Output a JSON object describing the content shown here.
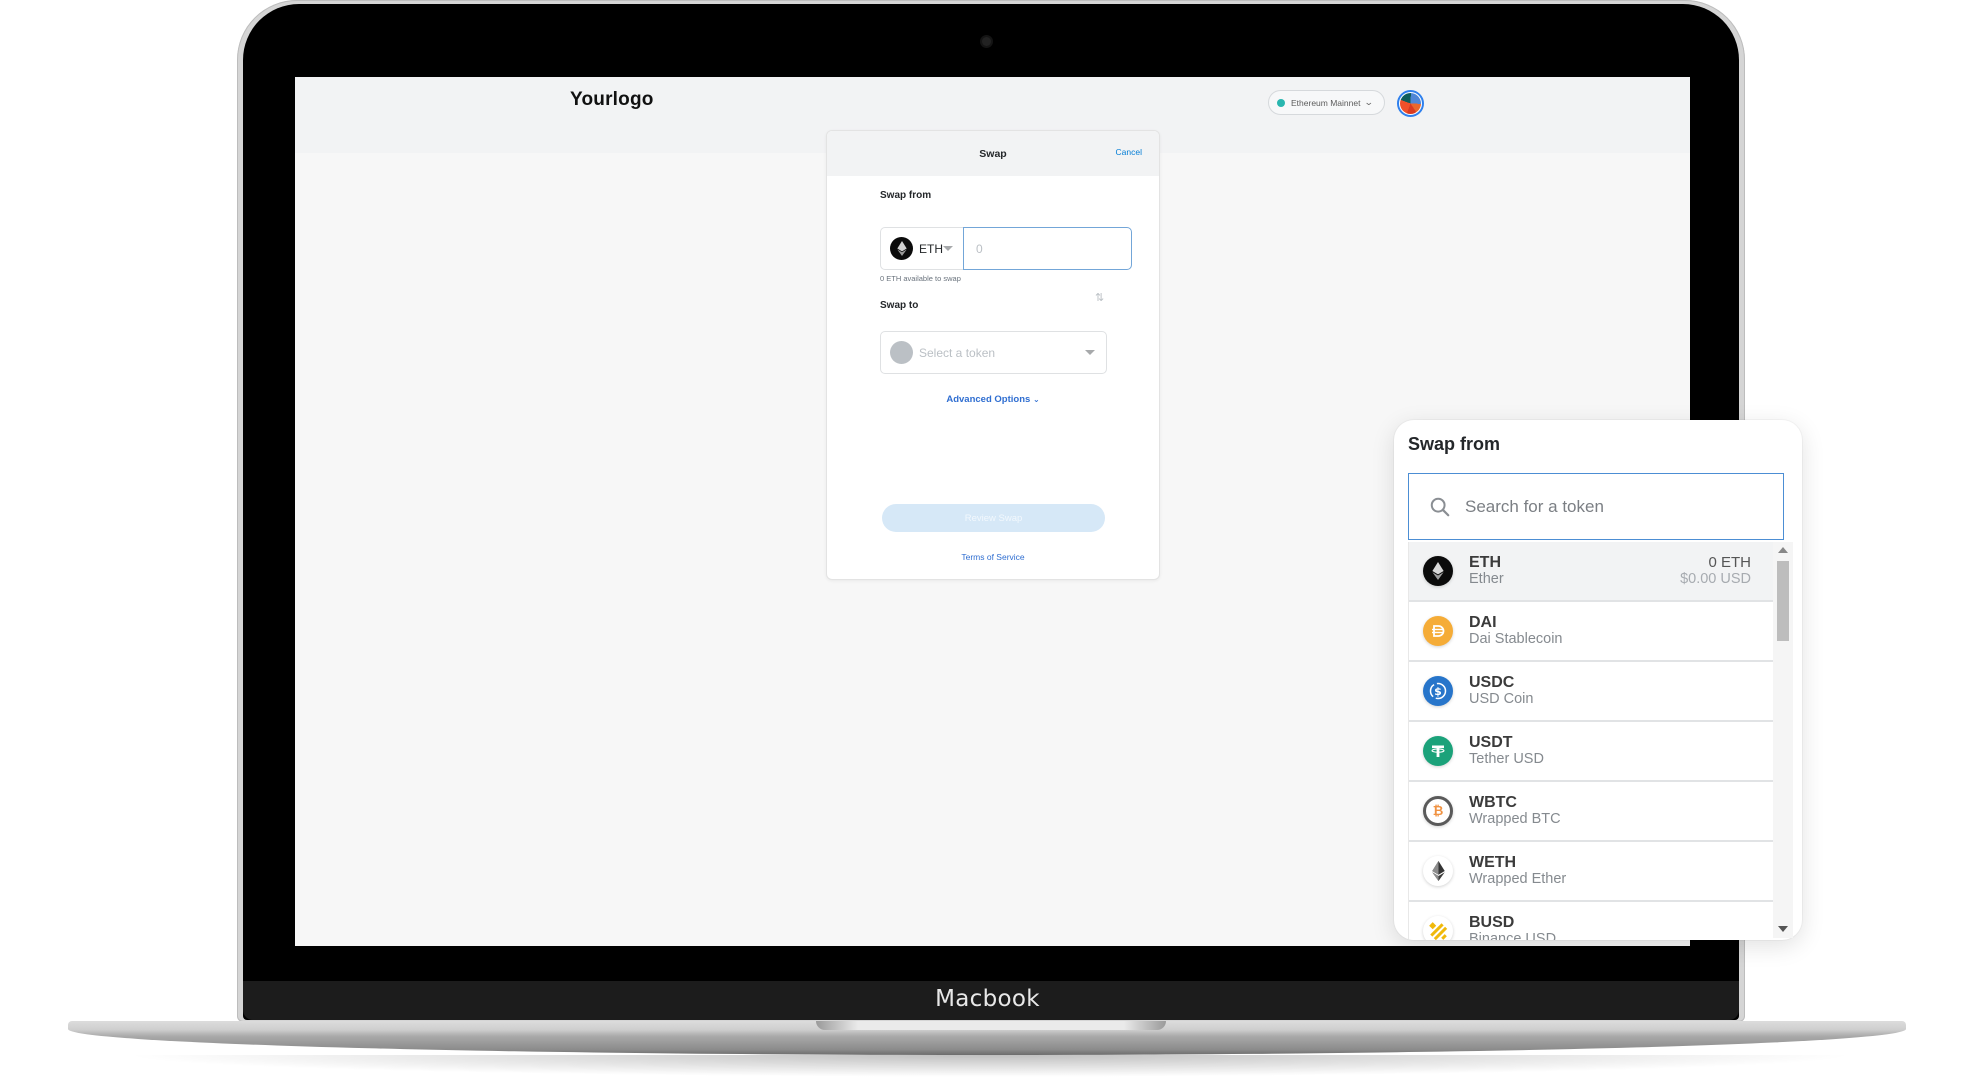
{
  "device": {
    "label": "Macbook"
  },
  "app": {
    "logo": "Yourlogo",
    "network": {
      "label": "Ethereum Mainnet",
      "status_color": "#29b6af"
    },
    "account_avatar": "account-avatar"
  },
  "swap_card": {
    "title": "Swap",
    "cancel_label": "Cancel",
    "from": {
      "label": "Swap from",
      "token": "ETH",
      "amount_placeholder": "0",
      "available": "0 ETH available to swap"
    },
    "switch_icon": "switch-arrows-icon",
    "to": {
      "label": "Swap to",
      "placeholder": "Select a token"
    },
    "advanced_options_label": "Advanced Options",
    "review_label": "Review Swap",
    "terms_label": "Terms of Service",
    "accent_color": "#037dd6"
  },
  "token_picker": {
    "title": "Swap from",
    "search_placeholder": "Search for a token",
    "tokens": [
      {
        "symbol": "ETH",
        "name": "Ether",
        "balance": "0 ETH",
        "balance_usd": "$0.00 USD",
        "selected": true,
        "icon": "eth-icon",
        "color": "#0b0b0b"
      },
      {
        "symbol": "DAI",
        "name": "Dai Stablecoin",
        "icon": "dai-icon",
        "color": "#f5ac37"
      },
      {
        "symbol": "USDC",
        "name": "USD Coin",
        "icon": "usdc-icon",
        "color": "#2775ca"
      },
      {
        "symbol": "USDT",
        "name": "Tether USD",
        "icon": "usdt-icon",
        "color": "#1ba27a"
      },
      {
        "symbol": "WBTC",
        "name": "Wrapped BTC",
        "icon": "wbtc-icon",
        "color": "#f09242"
      },
      {
        "symbol": "WETH",
        "name": "Wrapped Ether",
        "icon": "weth-icon",
        "color": "#343434"
      },
      {
        "symbol": "BUSD",
        "name": "Binance USD",
        "icon": "busd-icon",
        "color": "#f0b90b"
      }
    ]
  }
}
